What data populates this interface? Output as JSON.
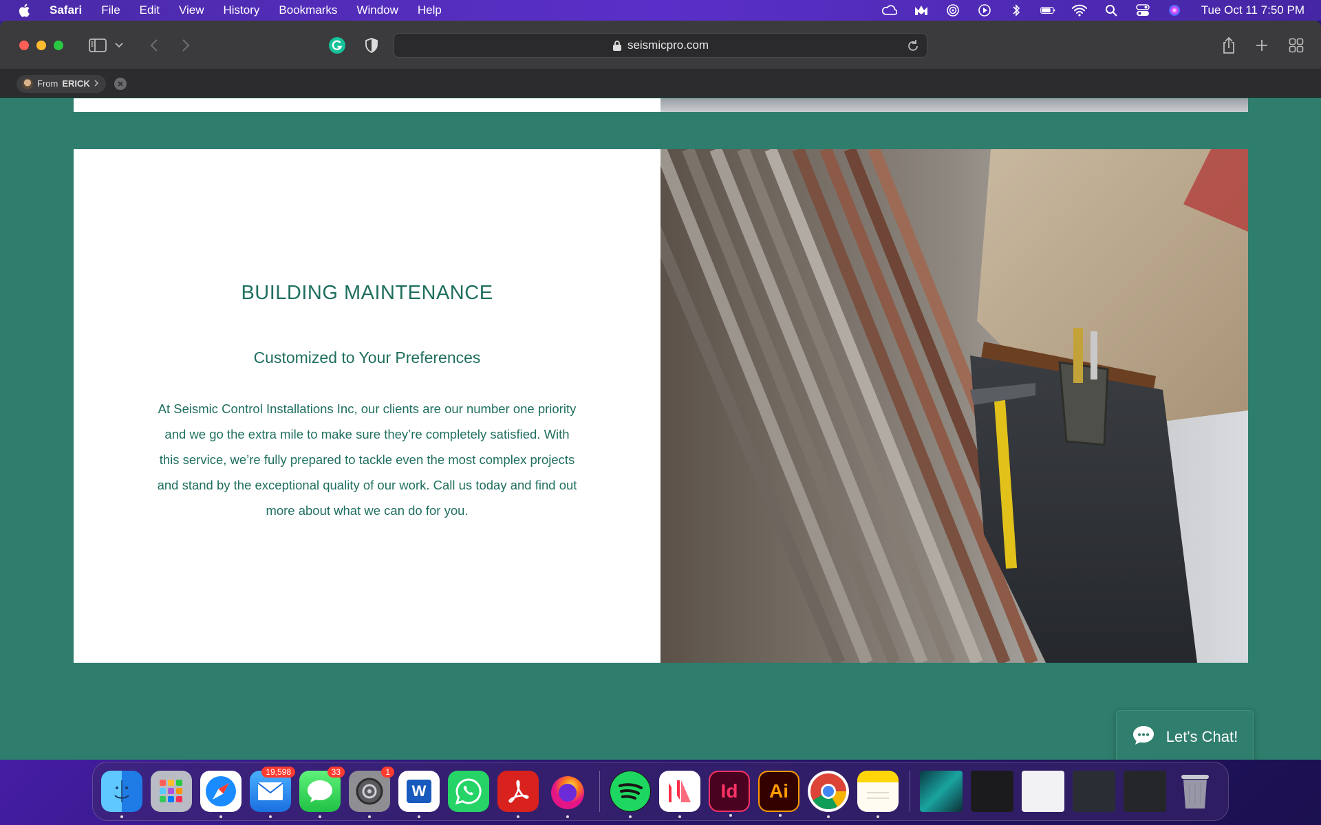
{
  "menubar": {
    "app_name": "Safari",
    "items": [
      "File",
      "Edit",
      "View",
      "History",
      "Bookmarks",
      "Window",
      "Help"
    ],
    "clock": "Tue Oct 11  7:50 PM",
    "status_icons": [
      "creative-cloud-icon",
      "malwarebytes-icon",
      "airdrop-icon",
      "play-icon",
      "bluetooth-icon",
      "battery-icon",
      "wifi-icon",
      "spotlight-icon",
      "control-center-icon",
      "siri-icon"
    ]
  },
  "browser": {
    "url": "seismicpro.com",
    "tab_group": {
      "prefix": "From",
      "name": "ERICK"
    }
  },
  "page": {
    "title": "BUILDING MAINTENANCE",
    "subtitle": "Customized to Your Preferences",
    "body": "At Seismic Control Installations Inc, our clients are our number one priority and we go the extra mile to make sure they’re completely satisfied. With this service, we’re fully prepared to tackle even the most complex projects and stand by the exceptional quality of our work. Call us today and find out more about what we can do for you.",
    "chat_label": "Let's Chat!"
  },
  "dock": {
    "badges": {
      "mail": "19,598",
      "messages": "33",
      "settings": "1"
    },
    "apps": [
      "Finder",
      "Launchpad",
      "Safari",
      "Mail",
      "Messages",
      "System Settings",
      "Word",
      "WhatsApp",
      "Acrobat",
      "Firefox",
      "Spotify",
      "News",
      "InDesign",
      "Illustrator",
      "Chrome",
      "Notes"
    ],
    "indesign_label": "Id",
    "illustrator_label": "Ai",
    "word_label": "W"
  },
  "colors": {
    "page_bg": "#2e7d6d",
    "heading": "#1f6f5f",
    "menubar": "#5a2fc9"
  }
}
